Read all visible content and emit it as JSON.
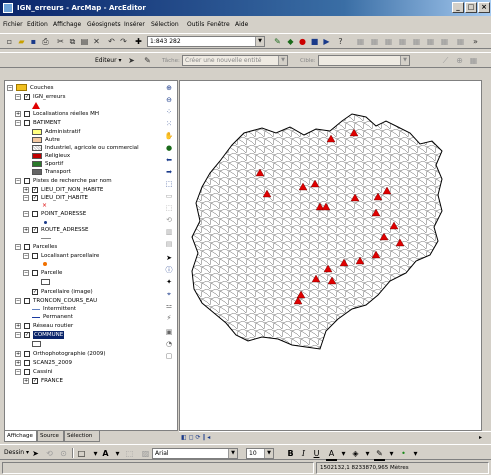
{
  "window": {
    "title": "IGN_erreurs - ArcMap - ArcEditor"
  },
  "menu": [
    "Fichier",
    "Edition",
    "Affichage",
    "Géosignets",
    "Insérer",
    "Sélection",
    "Outils",
    "Fenêtre",
    "Aide"
  ],
  "toolbar": {
    "scale": "1:843 282"
  },
  "editor": {
    "label": "Editeur ▾",
    "task_label": "Tâche:",
    "task_value": "Créer une nouvelle entité",
    "target_label": "Cible:"
  },
  "toc": {
    "root": "Couches",
    "items": [
      {
        "label": "IGN_erreurs"
      },
      {
        "label": "Localisations réelles MH"
      },
      {
        "label": "BATIMENT"
      },
      {
        "label": "Administratif"
      },
      {
        "label": "Autre"
      },
      {
        "label": "Industriel, agricole ou commercial"
      },
      {
        "label": "Religieux"
      },
      {
        "label": "Sportif"
      },
      {
        "label": "Transport"
      },
      {
        "label": "Pistes de recherche par nom"
      },
      {
        "label": "LIEU_DIT_NON_HABITE"
      },
      {
        "label": "LIEU_DIT_HABITE"
      },
      {
        "label": "POINT_ADRESSE"
      },
      {
        "label": "ROUTE_ADRESSE"
      },
      {
        "label": "Parcelles"
      },
      {
        "label": "Localisant parcellaire"
      },
      {
        "label": "Parcelle"
      },
      {
        "label": "Parcellaire (image)"
      },
      {
        "label": "TRONCON_COURS_EAU"
      },
      {
        "label": "Intermittent"
      },
      {
        "label": "Permanent"
      },
      {
        "label": "Réseau routier"
      },
      {
        "label": "COMMUNE"
      },
      {
        "label": "Orthophotographie (2009)"
      },
      {
        "label": "SCAN25_2009"
      },
      {
        "label": "Cassini"
      },
      {
        "label": "FRANCE"
      }
    ]
  },
  "tabs": [
    "Affichage",
    "Source",
    "Sélection"
  ],
  "drawing": {
    "label": "Dessin ▾",
    "font": "Arial",
    "size": "10"
  },
  "status": {
    "coords": "1502132,1  8233870,965 Mètres"
  },
  "colors": {
    "title_start": "#0a246a",
    "title_end": "#a6caf0",
    "error_marker": "#e00000",
    "selection": "#0a246a"
  }
}
